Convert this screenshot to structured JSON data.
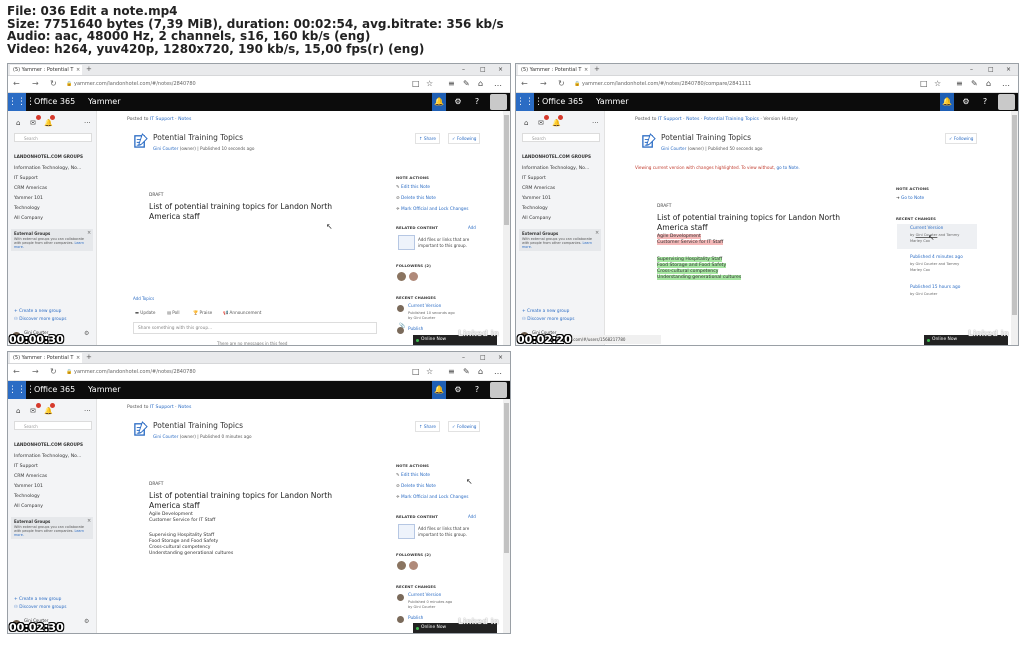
{
  "meta": {
    "file": "File: 036 Edit a note.mp4",
    "size": "Size: 7751640 bytes (7,39 MiB), duration: 00:02:54, avg.bitrate: 356 kb/s",
    "audio": "Audio: aac, 48000 Hz, 2 channels, s16, 160 kb/s (eng)",
    "video": "Video: h264, yuv420p, 1280x720, 190 kb/s, 15,00 fps(r) (eng)"
  },
  "browser": {
    "tab_title": "(5) Yammer : Potential T",
    "tab_close": "×",
    "tab_new": "+",
    "back": "←",
    "forward": "→",
    "reload": "↻",
    "lock": "🔒",
    "win_min": "–",
    "win_max": "□",
    "win_close": "×",
    "tools": [
      "□",
      "☆",
      "≡",
      "✎",
      "⌂",
      "…"
    ]
  },
  "suite": {
    "waffle": "⋮⋮⋮",
    "o365": "Office 365",
    "app": "Yammer",
    "bell": "🔔",
    "gear": "⚙",
    "help": "?"
  },
  "sidebar": {
    "home": "⌂",
    "mail": "✉",
    "bell": "🔔",
    "more": "···",
    "search_placeholder": "Search",
    "groups_heading": "LANDONHOTEL.COM GROUPS",
    "groups": [
      "Information Technology, No...",
      "IT Support",
      "CRM Americas",
      "Yammer 101",
      "Technology",
      "All Company"
    ],
    "external_title": "External Groups",
    "external_close": "×",
    "external_body": "With external groups you can collaborate with people from other companies.",
    "external_learn": "Learn more.",
    "create_group": "Create a new group",
    "discover_groups": "Discover more groups",
    "user_name": "Gini Courter",
    "gear": "⚙"
  },
  "note": {
    "posted_prefix": "Posted to",
    "group": "IT Support",
    "sep": "·",
    "notes": "Notes",
    "title": "Potential Training Topics",
    "author": "Gini Courter",
    "author_role": "(owner)",
    "published_1": "Published 10 seconds ago",
    "published_2": "Published 50 seconds ago",
    "published_3": "Published 0 minutes ago",
    "draft": "DRAFT",
    "doc_title": "List of potential training topics for Landon North America staff",
    "lines_group_a": [
      "Agile Development",
      "Customer Service for IT Staff"
    ],
    "lines_group_b": [
      "Supervising Hospitality Staff",
      "Food Storage and Food Safety",
      "Cross-cultural competency",
      "Understanding generational cultures"
    ],
    "share": "↑ Share",
    "following": "✓ Following"
  },
  "frame2": {
    "breadcrumb_extra": "Potential Training Topics",
    "breadcrumb_last": "Version History",
    "viewing": "Viewing current version with changes highlighted. To view without,",
    "viewing_link": "go to Note.",
    "go_to_note": "Go to Note",
    "current_version": "Current Version",
    "by_prefix": "by",
    "by_and": "and",
    "by_author_a": "Gini Courter",
    "by_author_b": "Tammy",
    "by_author_b2": "Marley Cox",
    "published_4min": "Published 4 minutes ago",
    "published_4min_by": "by Gini Courter and Tammy",
    "published_4min_by2": "Marley Cox",
    "published_15h": "Published 15 hours ago",
    "published_15h_by": "by Gini Courter"
  },
  "right": {
    "actions_heading": "NOTE ACTIONS",
    "edit": "Edit this Note",
    "delete": "Delete this Note",
    "official": "Mark Official and Lock Changes",
    "related_heading": "RELATED CONTENT",
    "add": "Add",
    "related_hint": "Add files or links that are important to this group.",
    "followers_heading": "FOLLOWERS (2)",
    "recent_heading": "RECENT CHANGES",
    "current_version": "Current Version",
    "published_10s": "Published 10 seconds ago",
    "published_0m": "Published 0 minutes ago",
    "by_gini": "by Gini Courter",
    "published_cut": "Publish"
  },
  "composer": {
    "add_topics": "Add Topics",
    "update": "Update",
    "poll": "Poll",
    "praise": "Praise",
    "announcement": "Announcement",
    "placeholder": "Share something with this group...",
    "clip": "📎",
    "cut_text": "There are no messages in this feed"
  },
  "misc": {
    "online_now": "Online Now",
    "linkedin": "Linked in",
    "url_overlay": "/n/landonhotel.com/#/users/1568217780",
    "cursor": "↖"
  },
  "timestamps": [
    "00:00:30",
    "00:02:20",
    "00:02:30"
  ],
  "urls": [
    "yammer.com/landonhotel.com/#/notes/2840780",
    "yammer.com/landonhotel.com/#/notes/2840780/compare/2841111",
    "yammer.com/landonhotel.com/#/notes/2840780"
  ]
}
